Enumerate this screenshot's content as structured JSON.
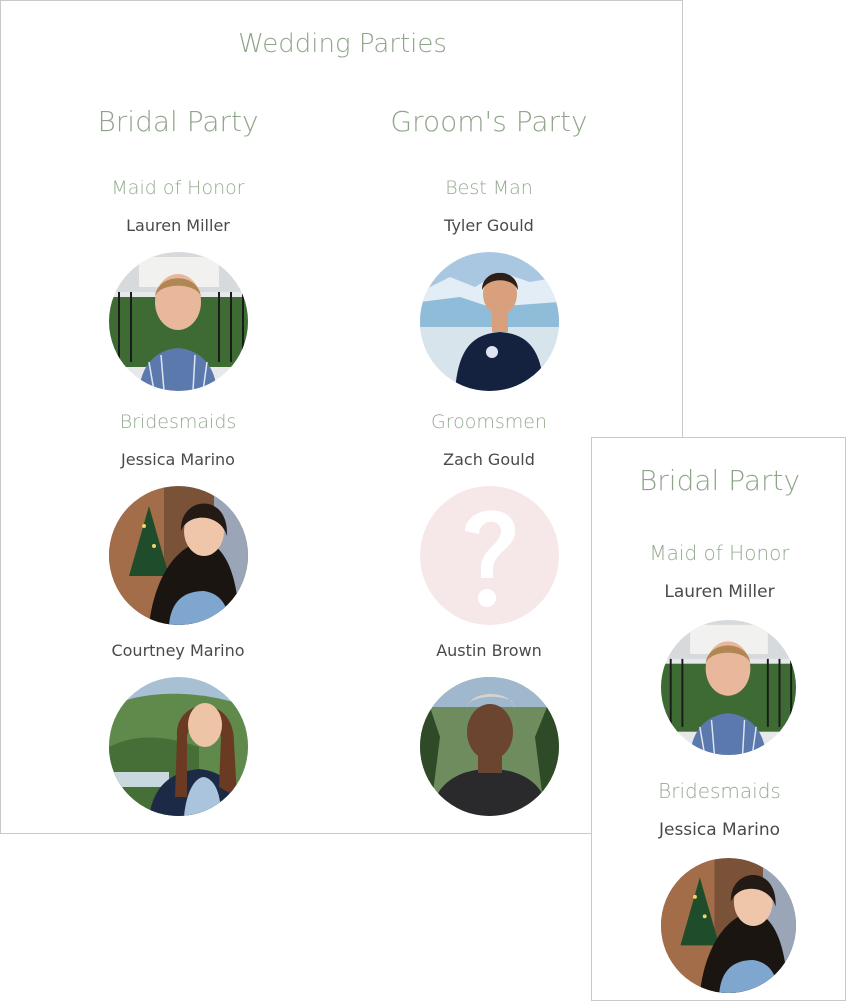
{
  "page": {
    "title": "Wedding Parties",
    "bridal": {
      "title": "Bridal Party",
      "honor_role": "Maid of Honor",
      "honor_name": "Lauren Miller",
      "maids_role": "Bridesmaids",
      "maid1_name": "Jessica Marino",
      "maid2_name": "Courtney Marino"
    },
    "groom": {
      "title": "Groom's Party",
      "best_role": "Best Man",
      "best_name": "Tyler Gould",
      "men_role": "Groomsmen",
      "man1_name": "Zach Gould",
      "man2_name": "Austin Brown"
    }
  },
  "mobile": {
    "title": "Bridal Party",
    "honor_role": "Maid of Honor",
    "honor_name": "Lauren Miller",
    "maids_role": "Bridesmaids",
    "maid1_name": "Jessica Marino"
  },
  "colors": {
    "accent_green": "#8fa58a",
    "text_dark": "#4a4a4a",
    "placeholder_bg": "#f6e8e8"
  }
}
